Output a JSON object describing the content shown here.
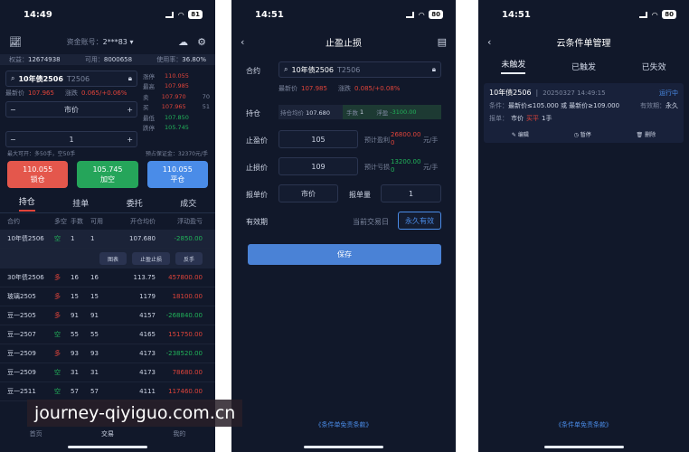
{
  "p1": {
    "time": "14:49",
    "battery": "81",
    "account_label": "资金账号：",
    "account": "2***83",
    "stats": {
      "equity_label": "权益：",
      "equity": "12674938",
      "available_label": "可用：",
      "available": "8000658",
      "usage_label": "使用率：",
      "usage": "36.80%"
    },
    "search": {
      "name": "10年债2506",
      "code": "T2506"
    },
    "quote": {
      "last_label": "最新价",
      "last": "107.965",
      "chg_label": "涨跌",
      "chg": "0.065/+0.06%"
    },
    "price_mode": "市价",
    "qty": "1",
    "quote_table": [
      {
        "label": "涨停",
        "value": "110.055",
        "vol": ""
      },
      {
        "label": "最高",
        "value": "107.985",
        "vol": ""
      },
      {
        "label": "卖",
        "value": "107.970",
        "vol": "70"
      },
      {
        "label": "买",
        "value": "107.965",
        "vol": "51"
      },
      {
        "label": "最低",
        "value": "107.850",
        "vol": ""
      },
      {
        "label": "跌停",
        "value": "105.745",
        "vol": ""
      }
    ],
    "max_open": "最大可开：多50手，空50手",
    "margin": "预占保证金：32370元/手",
    "buttons": [
      {
        "price": "110.055",
        "label": "锁仓"
      },
      {
        "price": "105.745",
        "label": "加空"
      },
      {
        "price": "110.055",
        "label": "平仓"
      }
    ],
    "tabs": [
      "持仓",
      "挂单",
      "委托",
      "成交"
    ],
    "columns": [
      "合约",
      "多空",
      "手数",
      "可用",
      "开仓均价",
      "浮动盈亏"
    ],
    "rows": [
      {
        "name": "10年债2506",
        "dir": "空",
        "lots": "1",
        "avail": "1",
        "avg": "107.680",
        "pnl": "-2850.00"
      },
      {
        "name": "30年债2506",
        "dir": "多",
        "lots": "16",
        "avail": "16",
        "avg": "113.75",
        "pnl": "457800.00"
      },
      {
        "name": "玻璃2505",
        "dir": "多",
        "lots": "15",
        "avail": "15",
        "avg": "1179",
        "pnl": "18100.00"
      },
      {
        "name": "豆一2505",
        "dir": "多",
        "lots": "91",
        "avail": "91",
        "avg": "4157",
        "pnl": "-268840.00"
      },
      {
        "name": "豆一2507",
        "dir": "空",
        "lots": "55",
        "avail": "55",
        "avg": "4165",
        "pnl": "151750.00"
      },
      {
        "name": "豆一2509",
        "dir": "多",
        "lots": "93",
        "avail": "93",
        "avg": "4173",
        "pnl": "-238520.00"
      },
      {
        "name": "豆一2509",
        "dir": "空",
        "lots": "31",
        "avail": "31",
        "avg": "4173",
        "pnl": "78680.00"
      },
      {
        "name": "豆一2511",
        "dir": "空",
        "lots": "57",
        "avail": "57",
        "avg": "4111",
        "pnl": "117460.00"
      }
    ],
    "row_actions": [
      "图表",
      "止盈止损",
      "反手"
    ],
    "bottom_nav": [
      "首页",
      "交易",
      "我的"
    ],
    "watermark": "journey-qiyiguo.com.cn"
  },
  "p2": {
    "time": "14:51",
    "battery": "80",
    "title": "止盈止损",
    "contract_label": "合约",
    "contract_name": "10年债2506",
    "contract_code": "T2506",
    "last_label": "最新价",
    "last": "107.985",
    "chg_label": "涨跌",
    "chg": "0.085/+0.08%",
    "position_label": "持仓",
    "avg_label": "持仓均价",
    "avg": "107.680",
    "lots_label": "手数",
    "lots": "1",
    "float_label": "浮盈",
    "float": "-3100.00",
    "tp_label": "止盈价",
    "tp_value": "105",
    "tp_est_label": "预计盈利",
    "tp_est": "26800.00",
    "tp_est2": "0",
    "unit": "元/手",
    "sl_label": "止损价",
    "sl_value": "109",
    "sl_est_label": "预计亏损",
    "sl_est": "13200.00",
    "sl_est2": "0",
    "order_price_label": "报单价",
    "order_price": "市价",
    "order_qty_label": "报单量",
    "order_qty": "1",
    "validity_label": "有效期",
    "validity_opt1": "当前交易日",
    "validity_opt2": "永久有效",
    "save": "保存",
    "terms": "《条件单免责条款》"
  },
  "p3": {
    "time": "14:51",
    "battery": "80",
    "title": "云条件单管理",
    "tabs": [
      "未触发",
      "已触发",
      "已失效"
    ],
    "card": {
      "name": "10年债2506",
      "date": "20250327 14:49:15",
      "status": "运行中",
      "cond_label": "条件：",
      "cond": "最新价≤105.000 或 最新价≥109.000",
      "valid_label": "有效期：",
      "valid": "永久",
      "order_label": "报单：",
      "order_price": "市价",
      "order_side": "买平",
      "order_qty": "1手",
      "actions": [
        "编辑",
        "暂停",
        "删除"
      ]
    },
    "terms": "《条件单免责条款》"
  },
  "colors": {
    "bg": "#11182a",
    "red": "#e0443a",
    "green": "#21b35a",
    "blue": "#4a8ce8"
  }
}
